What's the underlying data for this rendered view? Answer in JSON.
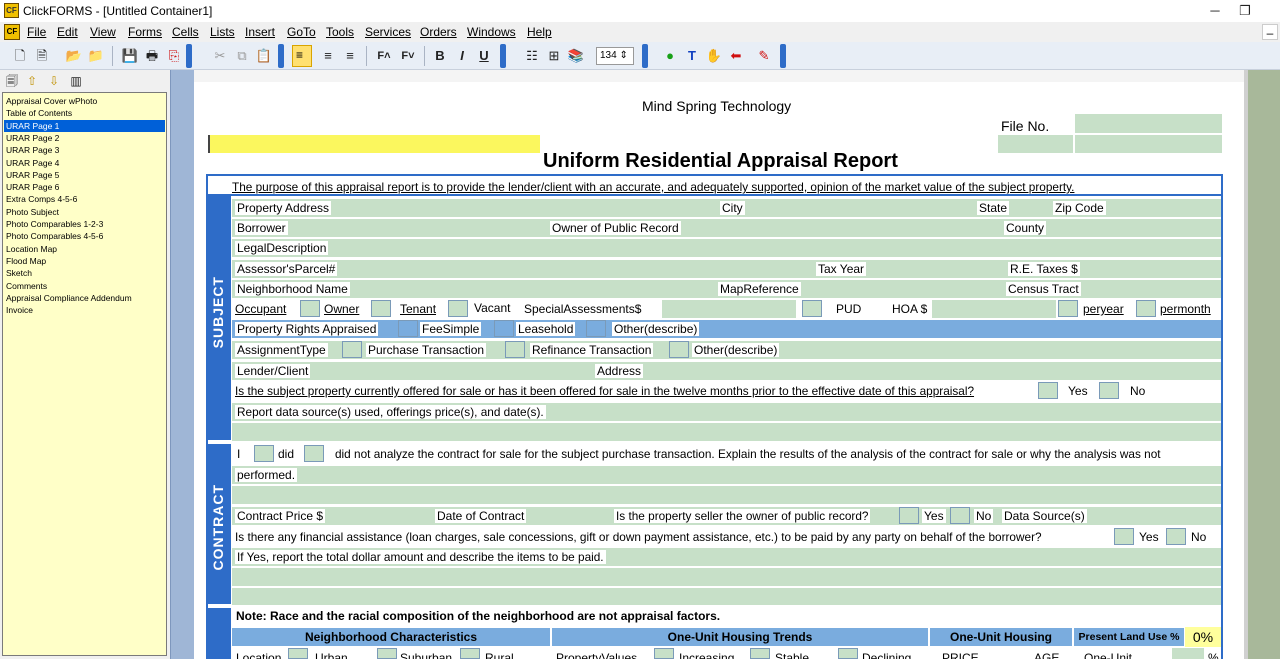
{
  "window": {
    "title": "ClickFORMS - [Untitled Container1]",
    "minimize": "─",
    "restore": "❐"
  },
  "menu": [
    "File",
    "Edit",
    "View",
    "Forms",
    "Cells",
    "Lists",
    "Insert",
    "GoTo",
    "Tools",
    "Services",
    "Orders",
    "Windows",
    "Help"
  ],
  "toolbar": {
    "zoom": "134"
  },
  "sidebar": {
    "items": [
      "Appraisal Cover wPhoto",
      "Table of Contents",
      "URAR Page 1",
      "URAR Page 2",
      "URAR Page 3",
      "URAR Page 4",
      "URAR Page 5",
      "URAR Page 6",
      "Extra Comps 4-5-6",
      "Photo Subject",
      "Photo Comparables 1-2-3",
      "Photo Comparables 4-5-6",
      "Location Map",
      "Flood Map",
      "Sketch",
      "Comments",
      "Appraisal Compliance Addendum",
      "Invoice"
    ],
    "selected_index": 2
  },
  "form": {
    "company": "Mind Spring Technology",
    "file_no": "File No.",
    "title": "Uniform Residential Appraisal Report",
    "purpose": "The purpose of this appraisal report is to provide the lender/client with an accurate, and adequately supported, opinion of the market value of the subject property.",
    "subject_tab": "SUBJECT",
    "contract_tab": "CONTRACT",
    "l_property_address": "Property Address",
    "l_city": "City",
    "l_state": "State",
    "l_zip": "Zip Code",
    "l_borrower": "Borrower",
    "l_owner_public": "Owner of Public Record",
    "l_county": "County",
    "l_legal": "LegalDescription",
    "l_parcel": "Assessor'sParcel#",
    "l_tax_year": "Tax Year",
    "l_taxes": "R.E. Taxes $",
    "l_neighborhood": "Neighborhood Name",
    "l_mapref": "MapReference",
    "l_census": "Census Tract",
    "l_occupant": "Occupant",
    "l_owner": "Owner",
    "l_tenant": "Tenant",
    "l_vacant": "Vacant",
    "l_special": "SpecialAssessments$",
    "l_pud": "PUD",
    "l_hoa": "HOA $",
    "l_peryear": "peryear",
    "l_permonth": "permonth",
    "l_rights": "Property Rights Appraised",
    "l_fee": "FeeSimple",
    "l_leasehold": "Leasehold",
    "l_other_describe": "Other(describe)",
    "l_assignment": "AssignmentType",
    "l_purchase": "Purchase Transaction",
    "l_refinance": "Refinance Transaction",
    "l_other_describe2": "Other(describe)",
    "l_lender": "Lender/Client",
    "l_address": "Address",
    "q_offered": "Is the subject property currently offered for sale or has it been offered for sale in the twelve months prior to the effective date of this appraisal?",
    "l_yes": "Yes",
    "l_no": "No",
    "l_report_source": "Report data source(s) used, offerings price(s), and date(s).",
    "c_i": "I",
    "c_did": "did",
    "c_text": "did not analyze the contract for sale for the subject purchase transaction. Explain the results of the analysis of the contract for sale or why the analysis was not",
    "c_performed": "performed.",
    "c_price": "Contract Price $",
    "c_date": "Date of Contract",
    "c_seller": "Is the property seller the owner of public record?",
    "c_yes": "Yes",
    "c_no": "No",
    "c_datasource": "Data Source(s)",
    "c_assistance": "Is there any financial assistance (loan charges, sale concessions, gift or down payment assistance, etc.) to be paid by any party on behalf of the borrower?",
    "c_yes2": "Yes",
    "c_no2": "No",
    "c_ifyes": "If Yes, report the total dollar amount and describe the items to be paid.",
    "n_note": "Note: Race and the racial composition of the neighborhood are not appraisal factors.",
    "n_char": "Neighborhood Characteristics",
    "n_trends": "One-Unit Housing Trends",
    "n_housing": "One-Unit Housing",
    "n_landuse": "Present Land Use %",
    "n_pct": "0%",
    "n_location": "Location",
    "n_urban": "Urban",
    "n_suburban": "Suburban",
    "n_rural": "Rural",
    "n_propvalues": "PropertyValues",
    "n_increasing": "Increasing",
    "n_stable": "Stable",
    "n_declining": "Declining",
    "n_price": "PRICE",
    "n_age": "AGE",
    "n_oneunit": "One-Unit",
    "n_pctsign": "%"
  }
}
